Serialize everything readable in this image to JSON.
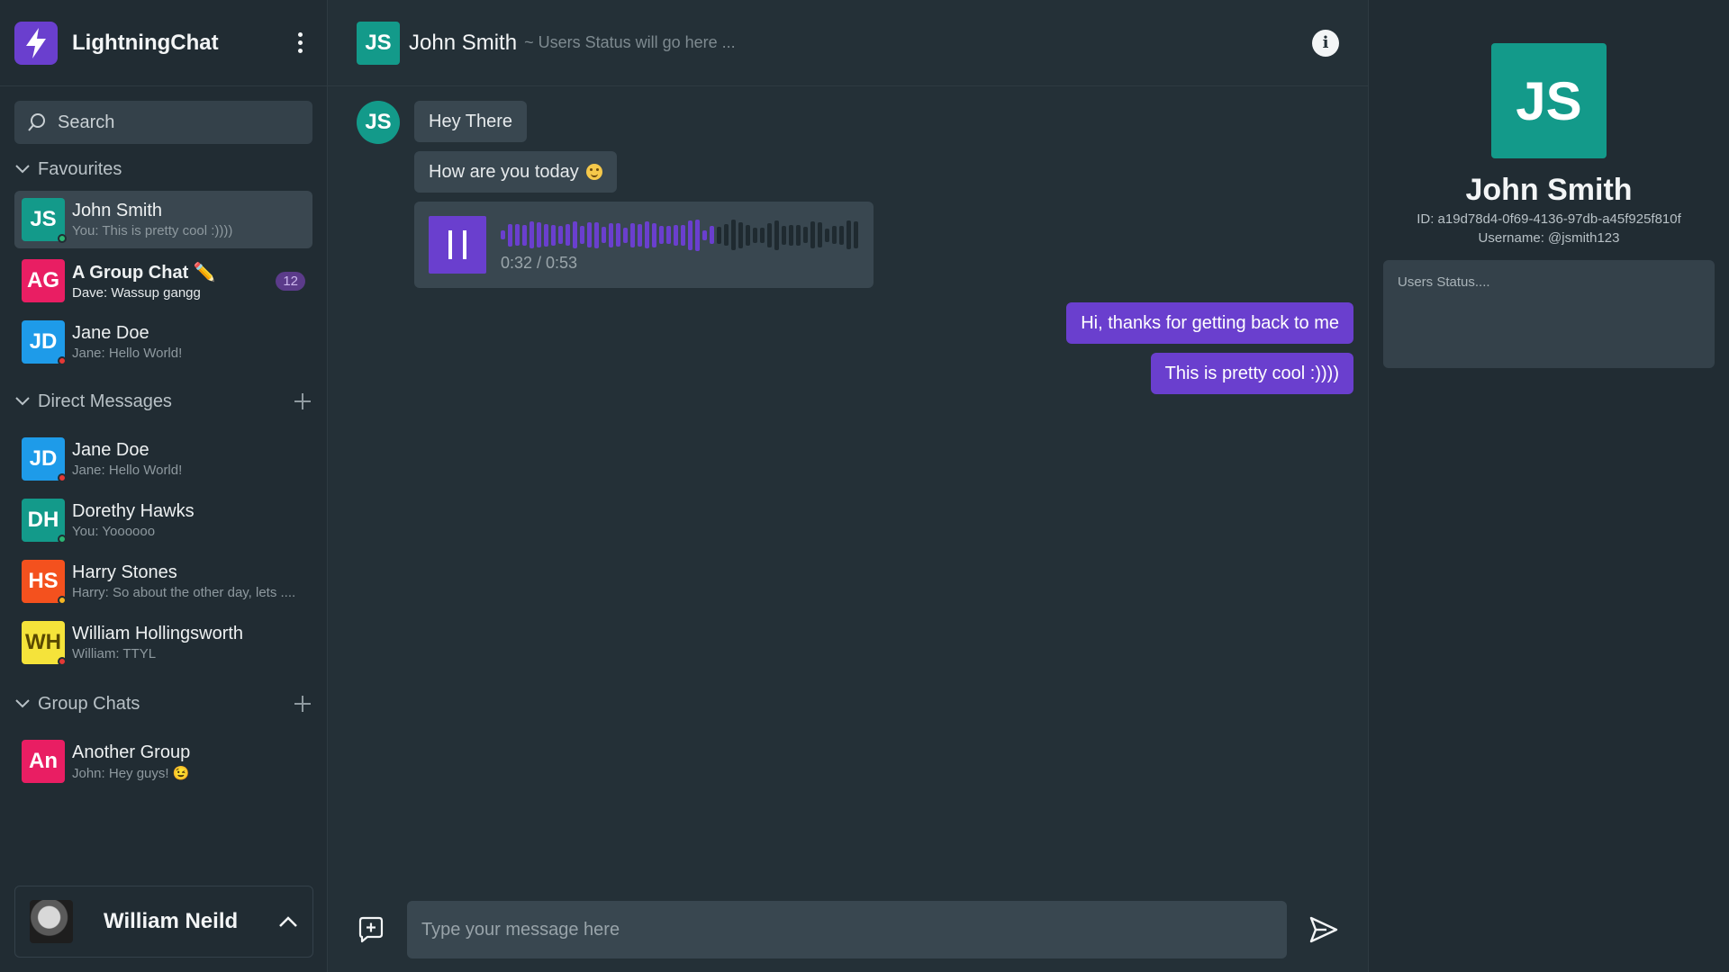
{
  "colors": {
    "accent": "#6a3fce",
    "bg": "#243037",
    "sidebar_bg": "#212c33",
    "online": "#2bb673",
    "busy": "#e53935",
    "away": "#f5b623"
  },
  "brand": {
    "name": "LightningChat",
    "logo_icon": "lightning-bolt-icon"
  },
  "search": {
    "label": "Search"
  },
  "sections": {
    "favourites": "Favourites",
    "direct_messages": "Direct Messages",
    "group_chats": "Group Chats"
  },
  "favourites": [
    {
      "initials": "JS",
      "name": "John Smith",
      "preview": "You: This is pretty cool :))))",
      "color": "#139a8a",
      "status_color": "#2bb673"
    },
    {
      "initials": "AG",
      "name": "A Group Chat ✏️",
      "preview": "Dave: Wassup gangg",
      "color": "#e91e63",
      "badge": "12"
    },
    {
      "initials": "JD",
      "name": "Jane Doe",
      "preview": "Jane: Hello World!",
      "color": "#1e9be9",
      "status_color": "#e53935"
    }
  ],
  "direct_messages": [
    {
      "initials": "JD",
      "name": "Jane Doe",
      "preview": "Jane: Hello World!",
      "color": "#1e9be9",
      "status_color": "#e53935"
    },
    {
      "initials": "DH",
      "name": "Dorethy Hawks",
      "preview": "You: Yoooooo",
      "color": "#139a8a",
      "status_color": "#2bb673"
    },
    {
      "initials": "HS",
      "name": "Harry Stones",
      "preview": "Harry: So about the other day, lets ....",
      "color": "#f4511e",
      "status_color": "#f5b623"
    },
    {
      "initials": "WH",
      "name": "William Hollingsworth",
      "preview": "William: TTYL",
      "color": "#f5e33a",
      "initials_color": "#5a4a00",
      "status_color": "#e53935"
    }
  ],
  "group_chats": [
    {
      "initials": "An",
      "name": "Another Group",
      "preview": "John: Hey guys! 😉",
      "color": "#e91e63"
    }
  ],
  "current_user": {
    "name": "William Neild"
  },
  "chat": {
    "initials": "JS",
    "title": "John Smith",
    "subtitle": "~ Users Status will go here ...",
    "incoming": {
      "initials": "JS",
      "m1": "Hey There",
      "m2": "How are you today",
      "voice_time": "0:32 / 0:53",
      "voice_progress": 0.6
    },
    "outgoing": {
      "m1": "Hi, thanks for getting back to me",
      "m2": "This is pretty cool :))))"
    },
    "input_placeholder": "Type your message here"
  },
  "profile": {
    "initials": "JS",
    "name": "John Smith",
    "id": "ID: a19d78d4-0f69-4136-97db-a45f925f810f",
    "username": "Username: @jsmith123",
    "status_placeholder": "Users Status...."
  }
}
